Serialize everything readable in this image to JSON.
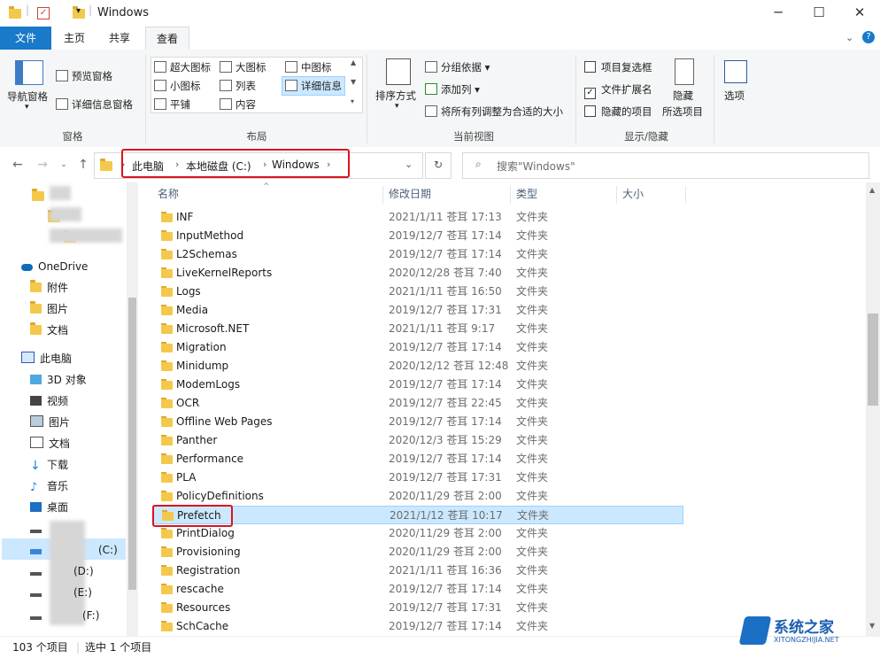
{
  "window": {
    "title": "Windows"
  },
  "tabs": [
    "文件",
    "主页",
    "共享",
    "查看"
  ],
  "ribbon": {
    "pane": {
      "nav": "导航窗格",
      "preview": "预览窗格",
      "details": "详细信息窗格",
      "label": "窗格"
    },
    "layout": {
      "items": [
        "超大图标",
        "大图标",
        "中图标",
        "小图标",
        "列表",
        "详细信息",
        "平铺",
        "内容"
      ],
      "label": "布局"
    },
    "view": {
      "sort": "排序方式",
      "group": "分组依据",
      "addcol": "添加列",
      "fit": "将所有列调整为合适的大小",
      "label": "当前视图"
    },
    "show": {
      "itemcheck": "项目复选框",
      "ext": "文件扩展名",
      "hidden": "隐藏的项目",
      "hide": "隐藏",
      "selected": "所选项目",
      "label": "显示/隐藏"
    },
    "options": "选项"
  },
  "address": {
    "segments": [
      "此电脑",
      "本地磁盘 (C:)",
      "Windows"
    ],
    "search_placeholder": "搜索\"Windows\""
  },
  "navpane": {
    "onedrive": "OneDrive",
    "onedrive_items": [
      "附件",
      "图片",
      "文档"
    ],
    "thispc": "此电脑",
    "pc_items": [
      "3D 对象",
      "视频",
      "图片",
      "文档",
      "下载",
      "音乐",
      "桌面"
    ],
    "drives": [
      "(C:)",
      "(D:)",
      "(E:)",
      "(F:)"
    ]
  },
  "columns": [
    "名称",
    "修改日期",
    "类型",
    "大小"
  ],
  "files": [
    {
      "name": "INF",
      "date": "2021/1/11 苍耳 17:13",
      "type": "文件夹"
    },
    {
      "name": "InputMethod",
      "date": "2019/12/7 苍耳 17:14",
      "type": "文件夹"
    },
    {
      "name": "L2Schemas",
      "date": "2019/12/7 苍耳 17:14",
      "type": "文件夹"
    },
    {
      "name": "LiveKernelReports",
      "date": "2020/12/28 苍耳 7:40",
      "type": "文件夹"
    },
    {
      "name": "Logs",
      "date": "2021/1/11 苍耳 16:50",
      "type": "文件夹"
    },
    {
      "name": "Media",
      "date": "2019/12/7 苍耳 17:31",
      "type": "文件夹"
    },
    {
      "name": "Microsoft.NET",
      "date": "2021/1/11 苍耳 9:17",
      "type": "文件夹"
    },
    {
      "name": "Migration",
      "date": "2019/12/7 苍耳 17:14",
      "type": "文件夹"
    },
    {
      "name": "Minidump",
      "date": "2020/12/12 苍耳 12:48",
      "type": "文件夹"
    },
    {
      "name": "ModemLogs",
      "date": "2019/12/7 苍耳 17:14",
      "type": "文件夹"
    },
    {
      "name": "OCR",
      "date": "2019/12/7 苍耳 22:45",
      "type": "文件夹"
    },
    {
      "name": "Offline Web Pages",
      "date": "2019/12/7 苍耳 17:14",
      "type": "文件夹"
    },
    {
      "name": "Panther",
      "date": "2020/12/3 苍耳 15:29",
      "type": "文件夹"
    },
    {
      "name": "Performance",
      "date": "2019/12/7 苍耳 17:14",
      "type": "文件夹"
    },
    {
      "name": "PLA",
      "date": "2019/12/7 苍耳 17:31",
      "type": "文件夹"
    },
    {
      "name": "PolicyDefinitions",
      "date": "2020/11/29 苍耳 2:00",
      "type": "文件夹"
    },
    {
      "name": "Prefetch",
      "date": "2021/1/12 苍耳 10:17",
      "type": "文件夹"
    },
    {
      "name": "PrintDialog",
      "date": "2020/11/29 苍耳 2:00",
      "type": "文件夹"
    },
    {
      "name": "Provisioning",
      "date": "2020/11/29 苍耳 2:00",
      "type": "文件夹"
    },
    {
      "name": "Registration",
      "date": "2021/1/11 苍耳 16:36",
      "type": "文件夹"
    },
    {
      "name": "rescache",
      "date": "2019/12/7 苍耳 17:14",
      "type": "文件夹"
    },
    {
      "name": "Resources",
      "date": "2019/12/7 苍耳 17:31",
      "type": "文件夹"
    },
    {
      "name": "SchCache",
      "date": "2019/12/7 苍耳 17:14",
      "type": "文件夹"
    }
  ],
  "status": {
    "count": "103 个项目",
    "selected": "选中 1 个项目"
  },
  "watermark": {
    "text": "系统之家",
    "sub": "XITONGZHIJIA.NET"
  }
}
